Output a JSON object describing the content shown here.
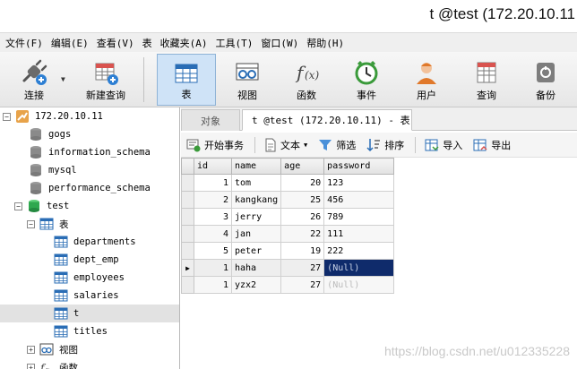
{
  "window": {
    "title": "t @test (172.20.10.11"
  },
  "menu": [
    "文件(F)",
    "编辑(E)",
    "查看(V)",
    "表",
    "收藏夹(A)",
    "工具(T)",
    "窗口(W)",
    "帮助(H)"
  ],
  "toolbar": {
    "connect": "连接",
    "new_query": "新建查询",
    "table": "表",
    "view": "视图",
    "function": "函数",
    "event": "事件",
    "user": "用户",
    "query": "查询",
    "backup": "备份"
  },
  "tree": {
    "connection": "172.20.10.11",
    "databases": [
      "gogs",
      "information_schema",
      "mysql",
      "performance_schema",
      "test"
    ],
    "tables_label": "表",
    "tables": [
      "departments",
      "dept_emp",
      "employees",
      "salaries",
      "t",
      "titles"
    ],
    "views_label": "视图",
    "functions_label": "函数"
  },
  "tabs": {
    "objects": "对象",
    "active": "t @test (172.20.10.11) - 表"
  },
  "subtoolbar": {
    "begin_tx": "开始事务",
    "text": "文本",
    "filter": "筛选",
    "sort": "排序",
    "import": "导入",
    "export": "导出"
  },
  "grid": {
    "columns": [
      "id",
      "name",
      "age",
      "password"
    ],
    "rows": [
      [
        "1",
        "tom",
        "20",
        "123"
      ],
      [
        "2",
        "kangkang",
        "25",
        "456"
      ],
      [
        "3",
        "jerry",
        "26",
        "789"
      ],
      [
        "4",
        "jan",
        "22",
        "111"
      ],
      [
        "5",
        "peter",
        "19",
        "222"
      ],
      [
        "1",
        "haha",
        "27",
        "(Null)"
      ],
      [
        "1",
        "yzx2",
        "27",
        "(Null)"
      ]
    ]
  },
  "watermark": "https://blog.csdn.net/u012335228",
  "colors": {
    "selection": "#0f2b6b",
    "active_tool": "#cfe3f7",
    "db_green": "#2fa84f"
  }
}
